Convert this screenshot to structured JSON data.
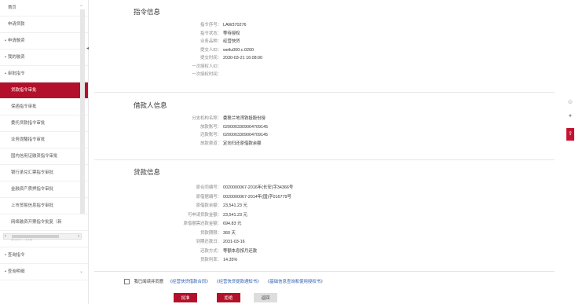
{
  "sidebar": {
    "items": [
      {
        "label": "首页",
        "type": "top"
      },
      {
        "label": "申请贷款",
        "type": "top"
      },
      {
        "label": "申请融资",
        "type": "parent"
      },
      {
        "label": "我的融资",
        "type": "parent"
      },
      {
        "label": "审批指令",
        "type": "parent"
      },
      {
        "label": "贷款指令审批",
        "type": "sub",
        "active": true
      },
      {
        "label": "保函指令审批",
        "type": "sub"
      },
      {
        "label": "委托贷款指令审批",
        "type": "sub"
      },
      {
        "label": "业务提醒指令审批",
        "type": "sub"
      },
      {
        "label": "国内信用证融资指令审批",
        "type": "sub"
      },
      {
        "label": "银行承兑汇票指令审批",
        "type": "sub"
      },
      {
        "label": "金融资产质押指令审批",
        "type": "sub"
      },
      {
        "label": "上市贸易信息指令审批",
        "type": "sub"
      },
      {
        "label": "网络融资开票指令批复（新",
        "type": "sub"
      },
      {
        "label": "额度承兑指令",
        "type": "sub"
      },
      {
        "label": "查询指令",
        "type": "parent"
      },
      {
        "label": "查询明细",
        "type": "parent"
      }
    ]
  },
  "instruction": {
    "title": "指令信息",
    "rows": [
      {
        "label": "指令序号：",
        "value": "LAW370276"
      },
      {
        "label": "指令状态：",
        "value": "等待授权"
      },
      {
        "label": "业务品种：",
        "value": "经营快贷"
      },
      {
        "label": "提交人ID：",
        "value": "weilu000.c.0200"
      },
      {
        "label": "提交时间：",
        "value": "2030-03-21 16:08:00"
      },
      {
        "label": "一次授权人ID：",
        "value": ""
      },
      {
        "label": "一次授权时间：",
        "value": ""
      }
    ]
  },
  "borrower": {
    "title": "借款人信息",
    "rows": [
      {
        "label": "分支机构名称：",
        "value": "委联兰地湾铁投股份授"
      },
      {
        "label": "放款账号：",
        "value": "0200003309004709145"
      },
      {
        "label": "还款账号：",
        "value": "0200003309004709145"
      },
      {
        "label": "放款渠道：",
        "value": "定向归还原借款余额"
      }
    ]
  },
  "loan": {
    "title": "贷款信息",
    "rows": [
      {
        "label": "原合同编号：",
        "value": "0020000067-2016年(长安)字34366号"
      },
      {
        "label": "原借据编号：",
        "value": "0020000067-2014年(国)字016779号"
      },
      {
        "label": "原借款余额：",
        "value": "23,541.23 元"
      },
      {
        "label": "可申请贷款金额：",
        "value": "23,541.23 元"
      },
      {
        "label": "原借据需还款金额：",
        "value": "694.83 元"
      },
      {
        "label": "贷款期限：",
        "value": "360 天"
      },
      {
        "label": "到期还款日：",
        "value": "2031-03-16"
      },
      {
        "label": "还款方式：",
        "value": "等额本息按月还款"
      },
      {
        "label": "贷款利率：",
        "value": "14.35%"
      }
    ]
  },
  "agreement": {
    "text": "我已阅读并同意",
    "links": [
      "《经营快贷借款合同》",
      "《经营快贷提款通知书》",
      "《基础信息查询和使用授权书》"
    ]
  },
  "buttons": {
    "approve": "批准",
    "reject": "拒绝",
    "back": "返回"
  },
  "tools": {
    "top_label": "⇧"
  }
}
